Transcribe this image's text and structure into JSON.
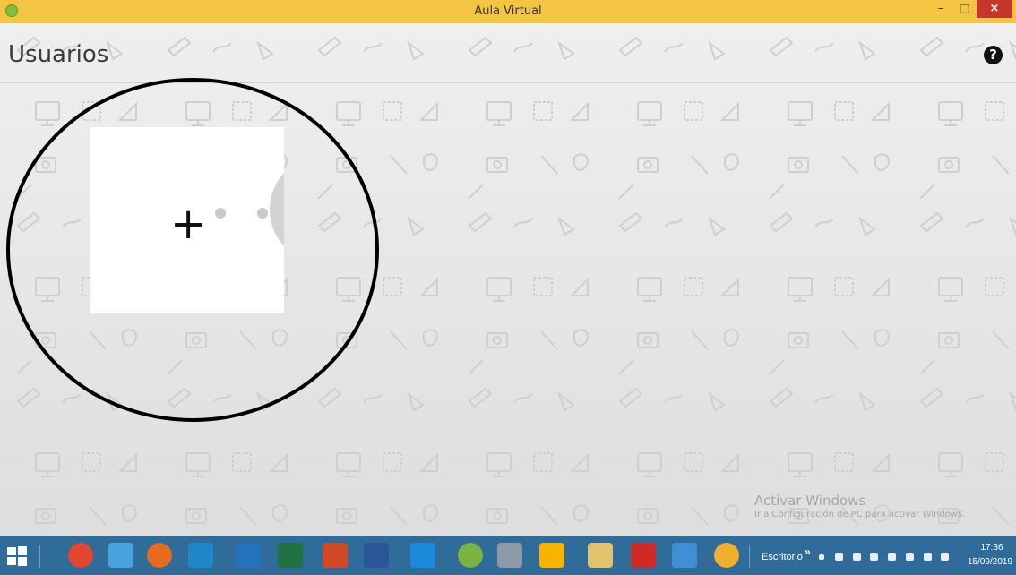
{
  "window": {
    "title": "Aula Virtual",
    "controls": {
      "minimize": "–",
      "maximize": "□",
      "close": "×"
    }
  },
  "page": {
    "title": "Usuarios",
    "help_label": "?"
  },
  "add_user_card": {
    "plus_label": "+",
    "avatar_icon": "child-avatar-icon"
  },
  "watermark": {
    "title": "Activar Windows",
    "subtitle": "Ir a Configuración de PC para activar Windows."
  },
  "taskbar": {
    "apps": [
      "chrome-icon",
      "edge-icon",
      "firefox-icon",
      "app-icon",
      "outlook-icon",
      "excel-icon",
      "powerpoint-icon",
      "word-icon",
      "onedrive-icon",
      "utorrent-icon",
      "paint-icon",
      "drive-icon",
      "file-explorer-icon",
      "acrobat-icon",
      "control-panel-icon",
      "aula-virtual-icon"
    ],
    "desktop_label": "Escritorio",
    "chevron": "»",
    "time": "17:36",
    "date": "15/09/2019"
  },
  "colors": {
    "titlebar": "#f4c542",
    "close": "#c7362a",
    "taskbar": "#2f6c99",
    "background": "#e8e8e8"
  }
}
